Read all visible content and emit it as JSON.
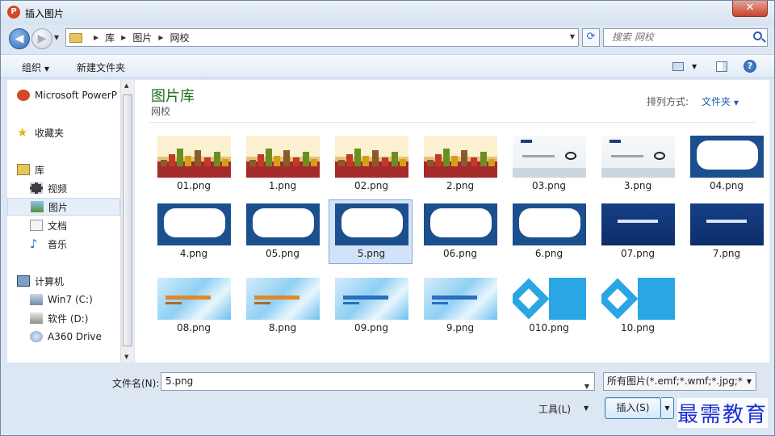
{
  "window": {
    "title": "插入图片",
    "app_icon": "P",
    "close": "✕"
  },
  "nav": {
    "breadcrumb": [
      "库",
      "图片",
      "网校"
    ],
    "search_placeholder": "搜索 网校"
  },
  "toolbar": {
    "organize": "组织",
    "new_folder": "新建文件夹"
  },
  "sidebar": {
    "items": [
      {
        "label": "Microsoft PowerP",
        "icon": "powerpoint-icon"
      },
      {
        "label": "收藏夹",
        "icon": "star-icon"
      },
      {
        "label": "库",
        "icon": "library-icon"
      },
      {
        "label": "视频",
        "icon": "video-icon"
      },
      {
        "label": "图片",
        "icon": "pictures-icon",
        "selected": true
      },
      {
        "label": "文档",
        "icon": "documents-icon"
      },
      {
        "label": "音乐",
        "icon": "music-icon"
      },
      {
        "label": "计算机",
        "icon": "computer-icon"
      },
      {
        "label": "Win7 (C:)",
        "icon": "drive-c-icon"
      },
      {
        "label": "软件 (D:)",
        "icon": "drive-d-icon"
      },
      {
        "label": "A360 Drive",
        "icon": "cloud-drive-icon"
      }
    ]
  },
  "library": {
    "title": "图片库",
    "subtitle": "网校",
    "sort_label": "排列方式:",
    "sort_value": "文件夹"
  },
  "files": [
    {
      "name": "01.png",
      "style": "city"
    },
    {
      "name": "1.png",
      "style": "city"
    },
    {
      "name": "02.png",
      "style": "city"
    },
    {
      "name": "2.png",
      "style": "city"
    },
    {
      "name": "03.png",
      "style": "white"
    },
    {
      "name": "3.png",
      "style": "white"
    },
    {
      "name": "04.png",
      "style": "cloud"
    },
    {
      "name": "4.png",
      "style": "cloud"
    },
    {
      "name": "05.png",
      "style": "cloud"
    },
    {
      "name": "5.png",
      "style": "cloud",
      "selected": true
    },
    {
      "name": "06.png",
      "style": "cloud"
    },
    {
      "name": "6.png",
      "style": "cloud"
    },
    {
      "name": "07.png",
      "style": "blue"
    },
    {
      "name": "7.png",
      "style": "blue"
    },
    {
      "name": "08.png",
      "style": "poly"
    },
    {
      "name": "8.png",
      "style": "poly"
    },
    {
      "name": "09.png",
      "style": "poly-blue"
    },
    {
      "name": "9.png",
      "style": "poly-blue"
    },
    {
      "name": "010.png",
      "style": "diamond"
    },
    {
      "name": "10.png",
      "style": "diamond"
    }
  ],
  "footer": {
    "filename_label": "文件名(N):",
    "filename_value": "5.png",
    "filetype": "所有图片(*.emf;*.wmf;*.jpg;*.jp",
    "tools": "工具(L)",
    "insert": "插入(S)",
    "watermark": "最需教育"
  }
}
